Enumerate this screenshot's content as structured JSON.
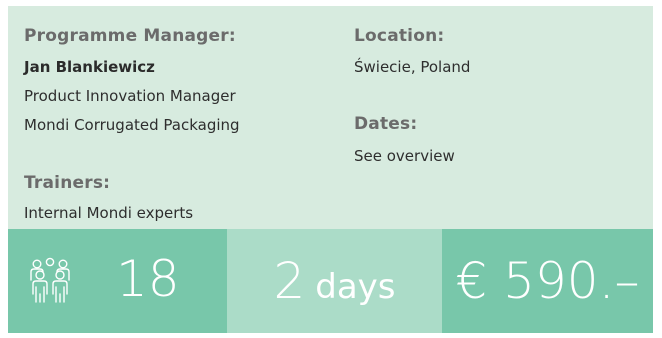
{
  "programme_manager": {
    "heading": "Programme Manager:",
    "name": "Jan Blankiewicz",
    "role": "Product Innovation Manager",
    "company": "Mondi Corrugated Packaging"
  },
  "trainers": {
    "heading": "Trainers:",
    "value": "Internal Mondi experts"
  },
  "location": {
    "heading": "Location:",
    "value": "Świecie, Poland"
  },
  "dates": {
    "heading": "Dates:",
    "value": "See overview"
  },
  "stats": {
    "participants_icon": "people-group-icon",
    "participants": "18",
    "duration_value": "2",
    "duration_unit": "days",
    "price": "€ 590.–"
  },
  "colors": {
    "card_bg": "#d7ebdf",
    "tile_dark": "#78c7aa",
    "tile_light": "#abdcc8"
  }
}
